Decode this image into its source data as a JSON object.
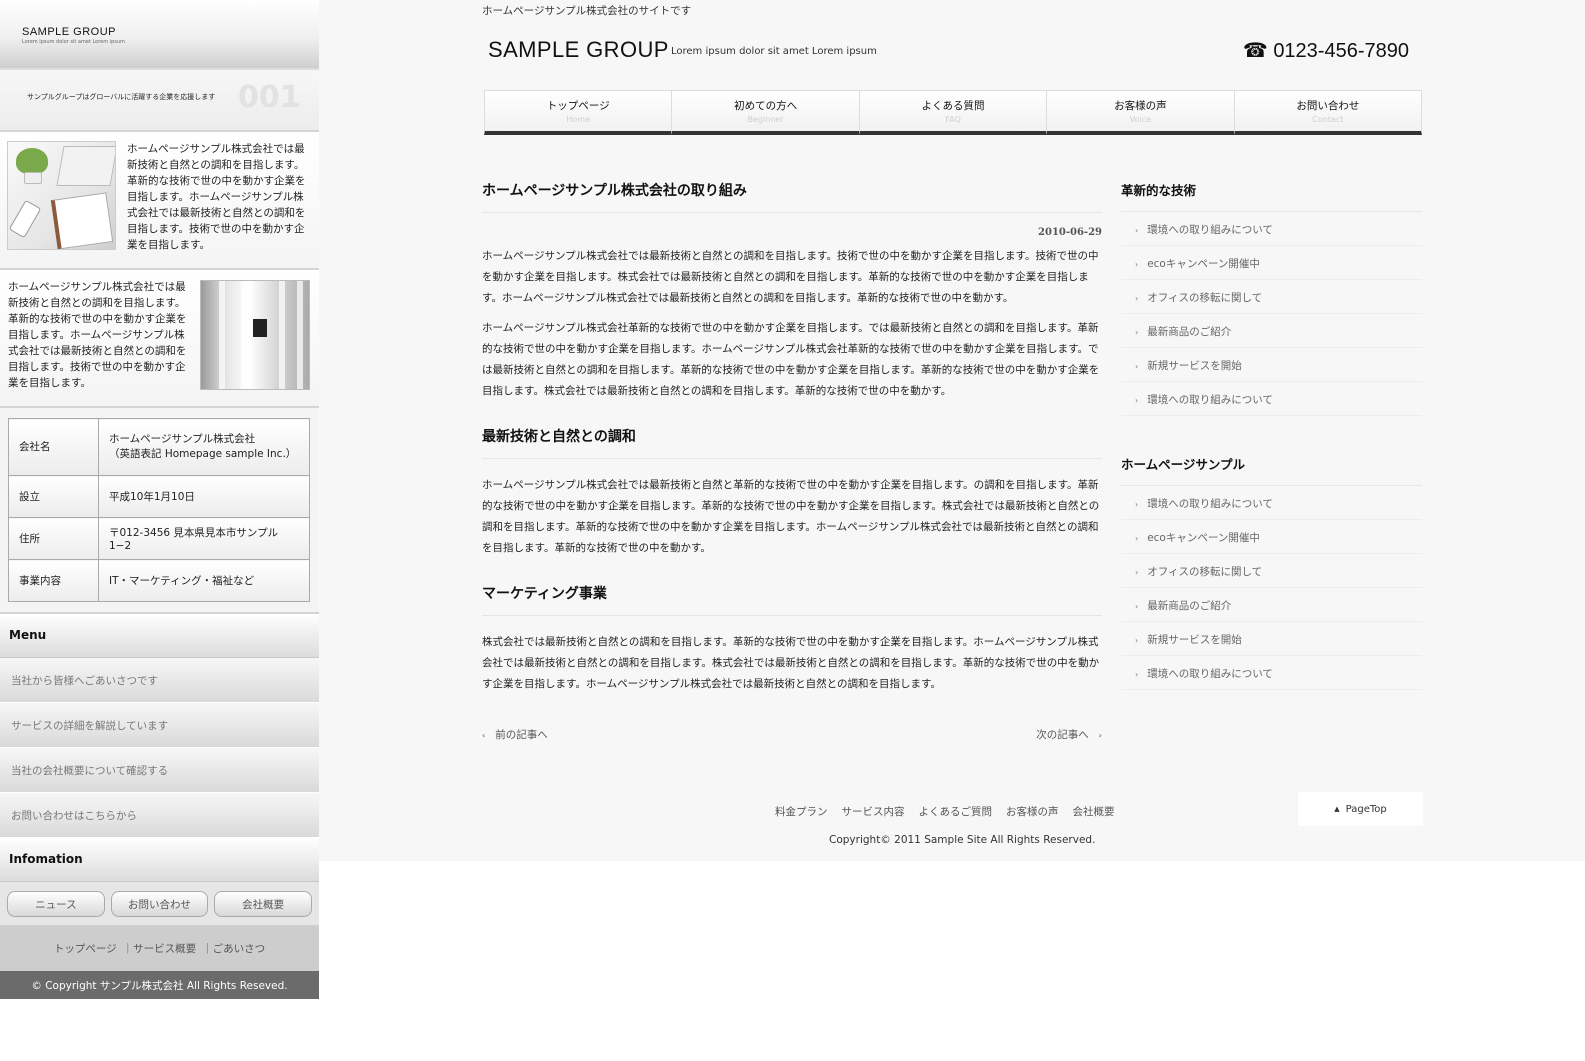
{
  "sidebar": {
    "logo": {
      "name": "SAMPLE GROUP",
      "tagline": "Lorem ipsum dolor sit amet Lorem ipsum"
    },
    "banner": {
      "text": "サンプルグループはグローバルに活躍する企業を応援します",
      "number": "001"
    },
    "block1_text": "ホームページサンプル株式会社では最新技術と自然との調和を目指します。革新的な技術で世の中を動かす企業を目指します。ホームページサンプル株式会社では最新技術と自然との調和を目指します。技術で世の中を動かす企業を目指します。",
    "block2_text": "ホームページサンプル株式会社では最新技術と自然との調和を目指します。革新的な技術で世の中を動かす企業を目指します。ホームページサンプル株式会社では最新技術と自然との調和を目指します。技術で世の中を動かす企業を目指します。",
    "company_table": [
      {
        "key": "会社名",
        "value": "ホームページサンプル株式会社",
        "value2": "（英語表記 Homepage sample Inc.）"
      },
      {
        "key": "設立",
        "value": "平成10年1月10日"
      },
      {
        "key": "住所",
        "value": "〒012-3456 見本県見本市サンプル1−2"
      },
      {
        "key": "事業内容",
        "value": "IT・マーケティング・福祉など"
      }
    ],
    "menu_title": "Menu",
    "menu_items": [
      "当社から皆様へごあいさつです",
      "サービスの詳細を解説しています",
      "当社の会社概要について確認する",
      "お問い合わせはこちらから"
    ],
    "info_title": "Infomation",
    "info_buttons": [
      "ニュース",
      "お問い合わせ",
      "会社概要"
    ],
    "footer_links": [
      "トップページ",
      "｜サービス概要",
      "｜ごあいさつ"
    ],
    "copyright": "© Copyright サンプル株式会社 All Rights Reseved."
  },
  "header": {
    "top_note": "ホームページサンプル株式会社のサイトです",
    "site_name": "SAMPLE GROUP",
    "tagline": "Lorem ipsum dolor sit amet Lorem ipsum",
    "phone": "☎ 0123-456-7890"
  },
  "nav": [
    {
      "jp": "トップページ",
      "en": "Home"
    },
    {
      "jp": "初めての方へ",
      "en": "Beginner"
    },
    {
      "jp": "よくある質問",
      "en": "FAQ"
    },
    {
      "jp": "お客様の声",
      "en": "Voice"
    },
    {
      "jp": "お問い合わせ",
      "en": "Contact"
    }
  ],
  "article": {
    "title": "ホームページサンプル株式会社の取り組み",
    "date": "2010-06-29",
    "p1": "ホームページサンプル株式会社では最新技術と自然との調和を目指します。技術で世の中を動かす企業を目指します。技術で世の中を動かす企業を目指します。株式会社では最新技術と自然との調和を目指します。革新的な技術で世の中を動かす企業を目指します。ホームページサンプル株式会社では最新技術と自然との調和を目指します。革新的な技術で世の中を動かす。",
    "p2": "ホームページサンプル株式会社革新的な技術で世の中を動かす企業を目指します。では最新技術と自然との調和を目指します。革新的な技術で世の中を動かす企業を目指します。ホームページサンプル株式会社革新的な技術で世の中を動かす企業を目指します。では最新技術と自然との調和を目指します。革新的な技術で世の中を動かす企業を目指します。革新的な技術で世の中を動かす企業を目指します。株式会社では最新技術と自然との調和を目指します。革新的な技術で世の中を動かす。",
    "h2": "最新技術と自然との調和",
    "p3": "ホームページサンプル株式会社では最新技術と自然と革新的な技術で世の中を動かす企業を目指します。の調和を目指します。革新的な技術で世の中を動かす企業を目指します。革新的な技術で世の中を動かす企業を目指します。株式会社では最新技術と自然との調和を目指します。革新的な技術で世の中を動かす企業を目指します。ホームページサンプル株式会社では最新技術と自然との調和を目指します。革新的な技術で世の中を動かす。",
    "h3": "マーケティング事業",
    "p4": "株式会社では最新技術と自然との調和を目指します。革新的な技術で世の中を動かす企業を目指します。ホームページサンプル株式会社では最新技術と自然との調和を目指します。株式会社では最新技術と自然との調和を目指します。革新的な技術で世の中を動かす企業を目指します。ホームページサンプル株式会社では最新技術と自然との調和を目指します。",
    "prev": "前の記事へ",
    "next": "次の記事へ"
  },
  "side": {
    "section1_title": "革新的な技術",
    "section1_items": [
      "環境への取り組みについて",
      "ecoキャンペーン開催中",
      "オフィスの移転に関して",
      "最新商品のご紹介",
      "新規サービスを開始",
      "環境への取り組みについて"
    ],
    "section2_title": "ホームページサンプル",
    "section2_items": [
      "環境への取り組みについて",
      "ecoキャンペーン開催中",
      "オフィスの移転に関して",
      "最新商品のご紹介",
      "新規サービスを開始",
      "環境への取り組みについて"
    ]
  },
  "footer": {
    "links": [
      "料金プラン",
      "サービス内容",
      "よくあるご質問",
      "お客様の声",
      "会社概要"
    ],
    "copyright": "Copyright© 2011 Sample Site All Rights Reserved.",
    "pagetop": "PageTop"
  }
}
